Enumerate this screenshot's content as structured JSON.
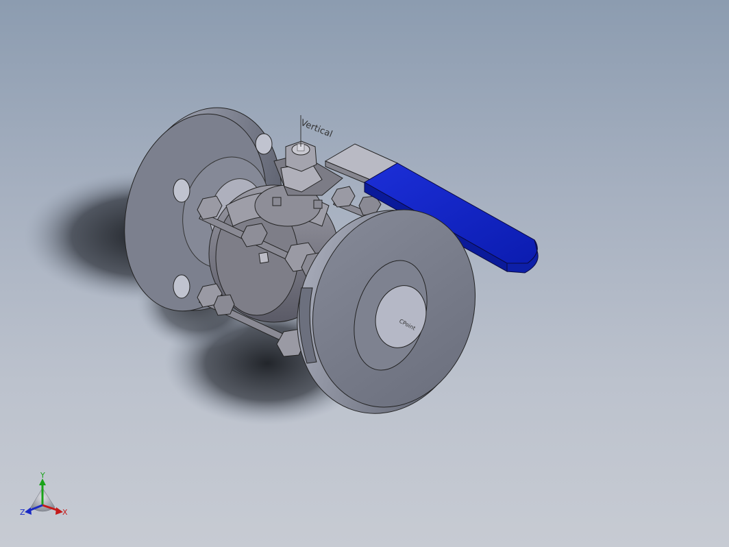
{
  "view": {
    "background_top": "#8c9cb0",
    "background_bottom": "#c7cbd3"
  },
  "model": {
    "name_hint": "ball-valve",
    "handle_color": "#0a1fc4",
    "body_color": "#7a7a86",
    "flange_color": "#767a88"
  },
  "annotations": {
    "vertical_label": "Vertical",
    "center_label": "CPoint"
  },
  "triad": {
    "y_label": "Y",
    "x_label": "X",
    "z_label": "Z",
    "y_color": "#1aa31a",
    "x_color": "#c41a1a",
    "z_color": "#1a2ac4"
  }
}
